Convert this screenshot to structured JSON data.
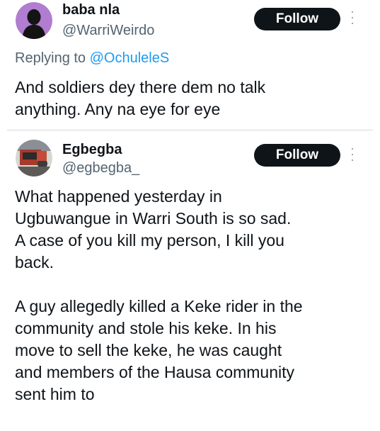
{
  "tweets": [
    {
      "name": "baba nla",
      "handle": "@WarriWeirdo",
      "follow_label": "Follow",
      "replying_prefix": "Replying to ",
      "replying_to": "@OchuleleS",
      "text": "And soldiers dey there dem no talk\nanything. Any na eye for eye"
    },
    {
      "name": "Egbegba",
      "handle": "@egbegba_",
      "follow_label": "Follow",
      "text": "What happened yesterday in\nUgbuwangue in Warri South is so sad.\nA case of you kill my person, I kill you\nback.\n\nA guy allegedly killed a Keke rider in the\ncommunity and stole his keke. In his\nmove to sell the keke, he was caught\nand members of the Hausa community\nsent him to"
    }
  ],
  "icons": {
    "more": "more-vertical-icon",
    "avatar1": "default-avatar-silhouette",
    "avatar2": "profile-photo"
  },
  "colors": {
    "follow_bg": "#0f1419",
    "mention": "#1d9bf0",
    "secondary_text": "#536471"
  }
}
